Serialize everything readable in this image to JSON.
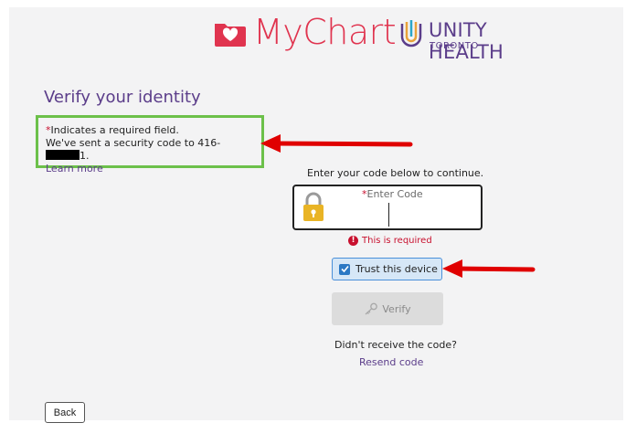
{
  "header": {
    "mychart_logo_text": "MyChart",
    "unity_logo_line1": "UNITY HEALTH",
    "unity_logo_line2": "TORONTO"
  },
  "page": {
    "title": "Verify your identity"
  },
  "info": {
    "required_star": "*",
    "required_note": "Indicates a required field.",
    "code_sent_prefix": "We've sent a security code to 416-",
    "code_sent_suffix": "1.",
    "learn_more": "Learn more"
  },
  "form": {
    "instruction": "Enter your code below to continue.",
    "code_label_star": "*",
    "code_label": "Enter Code",
    "code_value": "",
    "error_text": "This is required",
    "trust_label": "Trust this device",
    "trust_checked": true,
    "verify_label": "Verify",
    "no_code_text": "Didn't receive the code?",
    "resend_label": "Resend code"
  },
  "footer": {
    "back_label": "Back"
  },
  "colors": {
    "brand_purple": "#5b3d8a",
    "mychart_red": "#e0344f",
    "error_red": "#c8102e",
    "annotation_green": "#6cc04a",
    "arrow_red": "#e00000"
  },
  "icons": {
    "mychart": "folder-heart-icon",
    "unity": "unity-mark-icon",
    "lock": "lock-icon",
    "error": "error-icon",
    "checkbox": "checkbox-checked-icon",
    "verify": "key-icon"
  }
}
